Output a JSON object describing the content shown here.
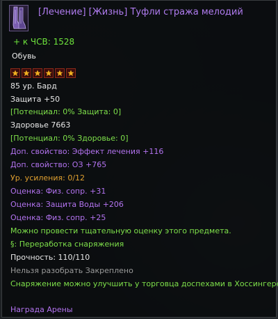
{
  "item": {
    "title": "[Лечение]  [Жизнь]  Туфли стража мелодий",
    "main_stat": "+ к ЧСВ: 1528",
    "slot": "Обувь",
    "grade_stars": 6,
    "level_class": "85 ур.   Бард",
    "defense": "Защита +50",
    "potential_defense": "[Потенциал: 0% Защита: 0]",
    "health": "Здоровье 7663",
    "potential_health": "[Потенциал: 0% Здоровье: 0]",
    "extra_1": "Доп. свойство: Эффект лечения +116",
    "extra_2": "Доп. свойство: ОЗ +765",
    "enhance_level": "Ур. усиления: 0/12",
    "appraisal_1": "Оценка:  Физ. сопр. +31",
    "appraisal_2": "Оценка:  Защита Воды +206",
    "appraisal_3": "Оценка:  Физ. сопр. +25",
    "appraisal_note": "Можно провести тщательную оценку этого предмета.",
    "rework": "§: Переработка снаряжения",
    "durability": "Прочность: 110/110",
    "restrictions": "Нельзя разобрать   Закреплено",
    "upgrade_note": "Снаряжение можно улучшить у торговца доспехами в Хоссингере.",
    "source": "Награда Арены"
  },
  "colors": {
    "title": "#b07cf0",
    "green": "#7ee04a",
    "purple": "#b373f0",
    "orange": "#e0a030",
    "gray": "#9a9a9a"
  }
}
